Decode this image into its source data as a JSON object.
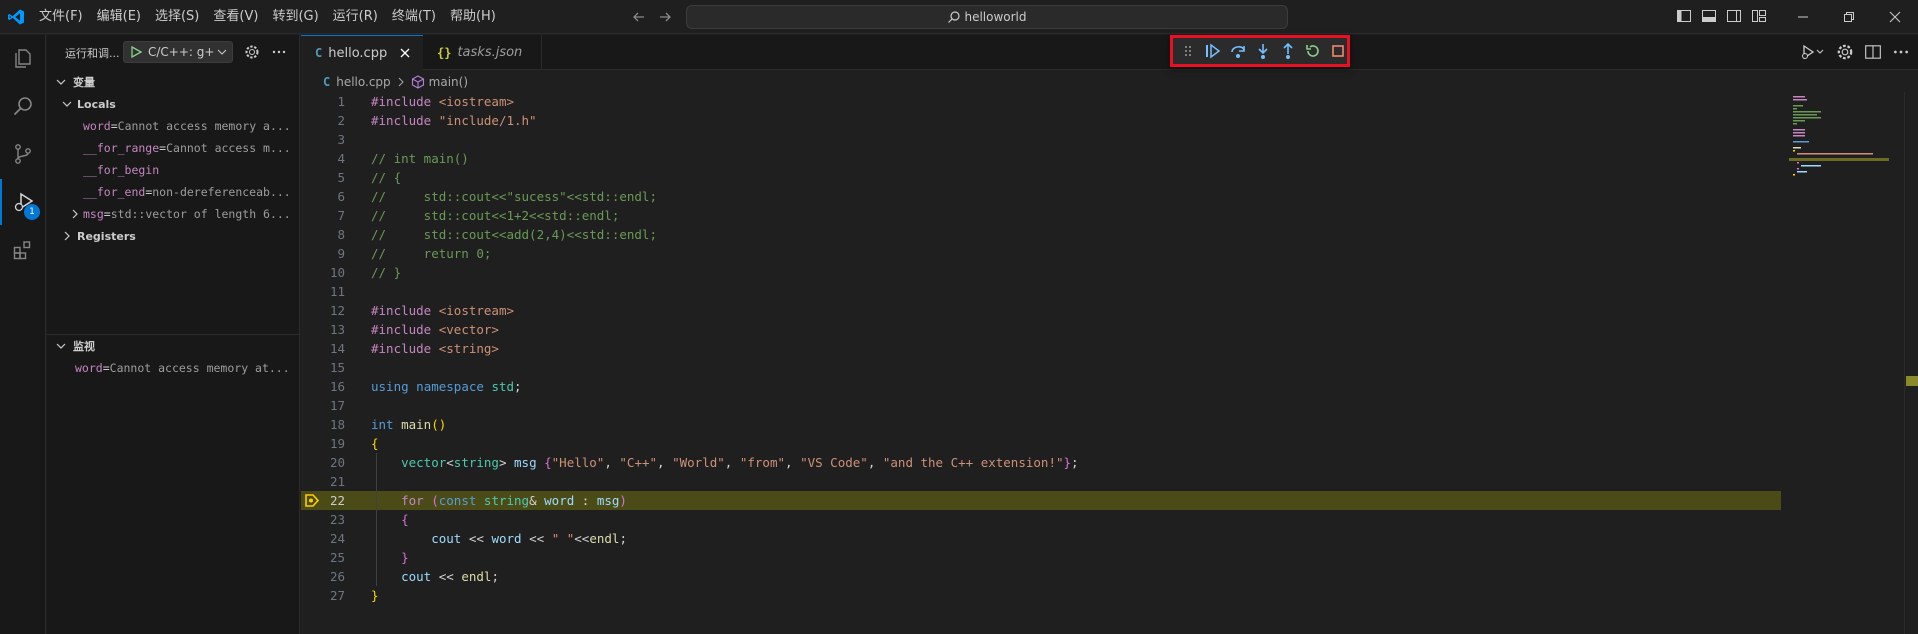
{
  "menubar": [
    "文件(F)",
    "编辑(E)",
    "选择(S)",
    "查看(V)",
    "转到(G)",
    "运行(R)",
    "终端(T)",
    "帮助(H)"
  ],
  "command_center": "helloworld",
  "activity": {
    "badge": "1"
  },
  "sidebar": {
    "title": "运行和调...",
    "config": "C/C++: g+",
    "variables_header": "变量",
    "locals_label": "Locals",
    "locals": [
      {
        "name": "word",
        "value": "Cannot access memory a..."
      },
      {
        "name": "__for_range",
        "value": "Cannot access m..."
      },
      {
        "name": "__for_begin",
        "value": ""
      },
      {
        "name": "__for_end",
        "value": "non-dereferenceab..."
      },
      {
        "name": "msg",
        "value": "std::vector of length 6..."
      }
    ],
    "registers_label": "Registers",
    "watch_header": "监视",
    "watch": [
      {
        "name": "word",
        "value": "Cannot access memory at..."
      }
    ]
  },
  "tabs": [
    {
      "label": "hello.cpp",
      "icon": "C"
    },
    {
      "label": "tasks.json",
      "icon": "{}"
    }
  ],
  "breadcrumbs": {
    "file": "hello.cpp",
    "symbol": "main()"
  },
  "code": {
    "current_line": 22,
    "lines": [
      "#include <iostream>",
      "#include \"include/1.h\"",
      "",
      "// int main()",
      "// {",
      "//     std::cout<<\"sucess\"<<std::endl;",
      "//     std::cout<<1+2<<std::endl;",
      "//     std::cout<<add(2,4)<<std::endl;",
      "//     return 0;",
      "// }",
      "",
      "#include <iostream>",
      "#include <vector>",
      "#include <string>",
      "",
      "using namespace std;",
      "",
      "int main()",
      "{",
      "    vector<string> msg {\"Hello\", \"C++\", \"World\", \"from\", \"VS Code\", \"and the C++ extension!\"};",
      "",
      "    for (const string& word : msg)",
      "    {",
      "        cout << word << \" \"<<endl;",
      "    }",
      "    cout << endl;",
      "}"
    ]
  },
  "colors": {
    "accent": "#0078d4",
    "highlight_border": "#e81123",
    "current_line_bg": "#4b4b18"
  }
}
